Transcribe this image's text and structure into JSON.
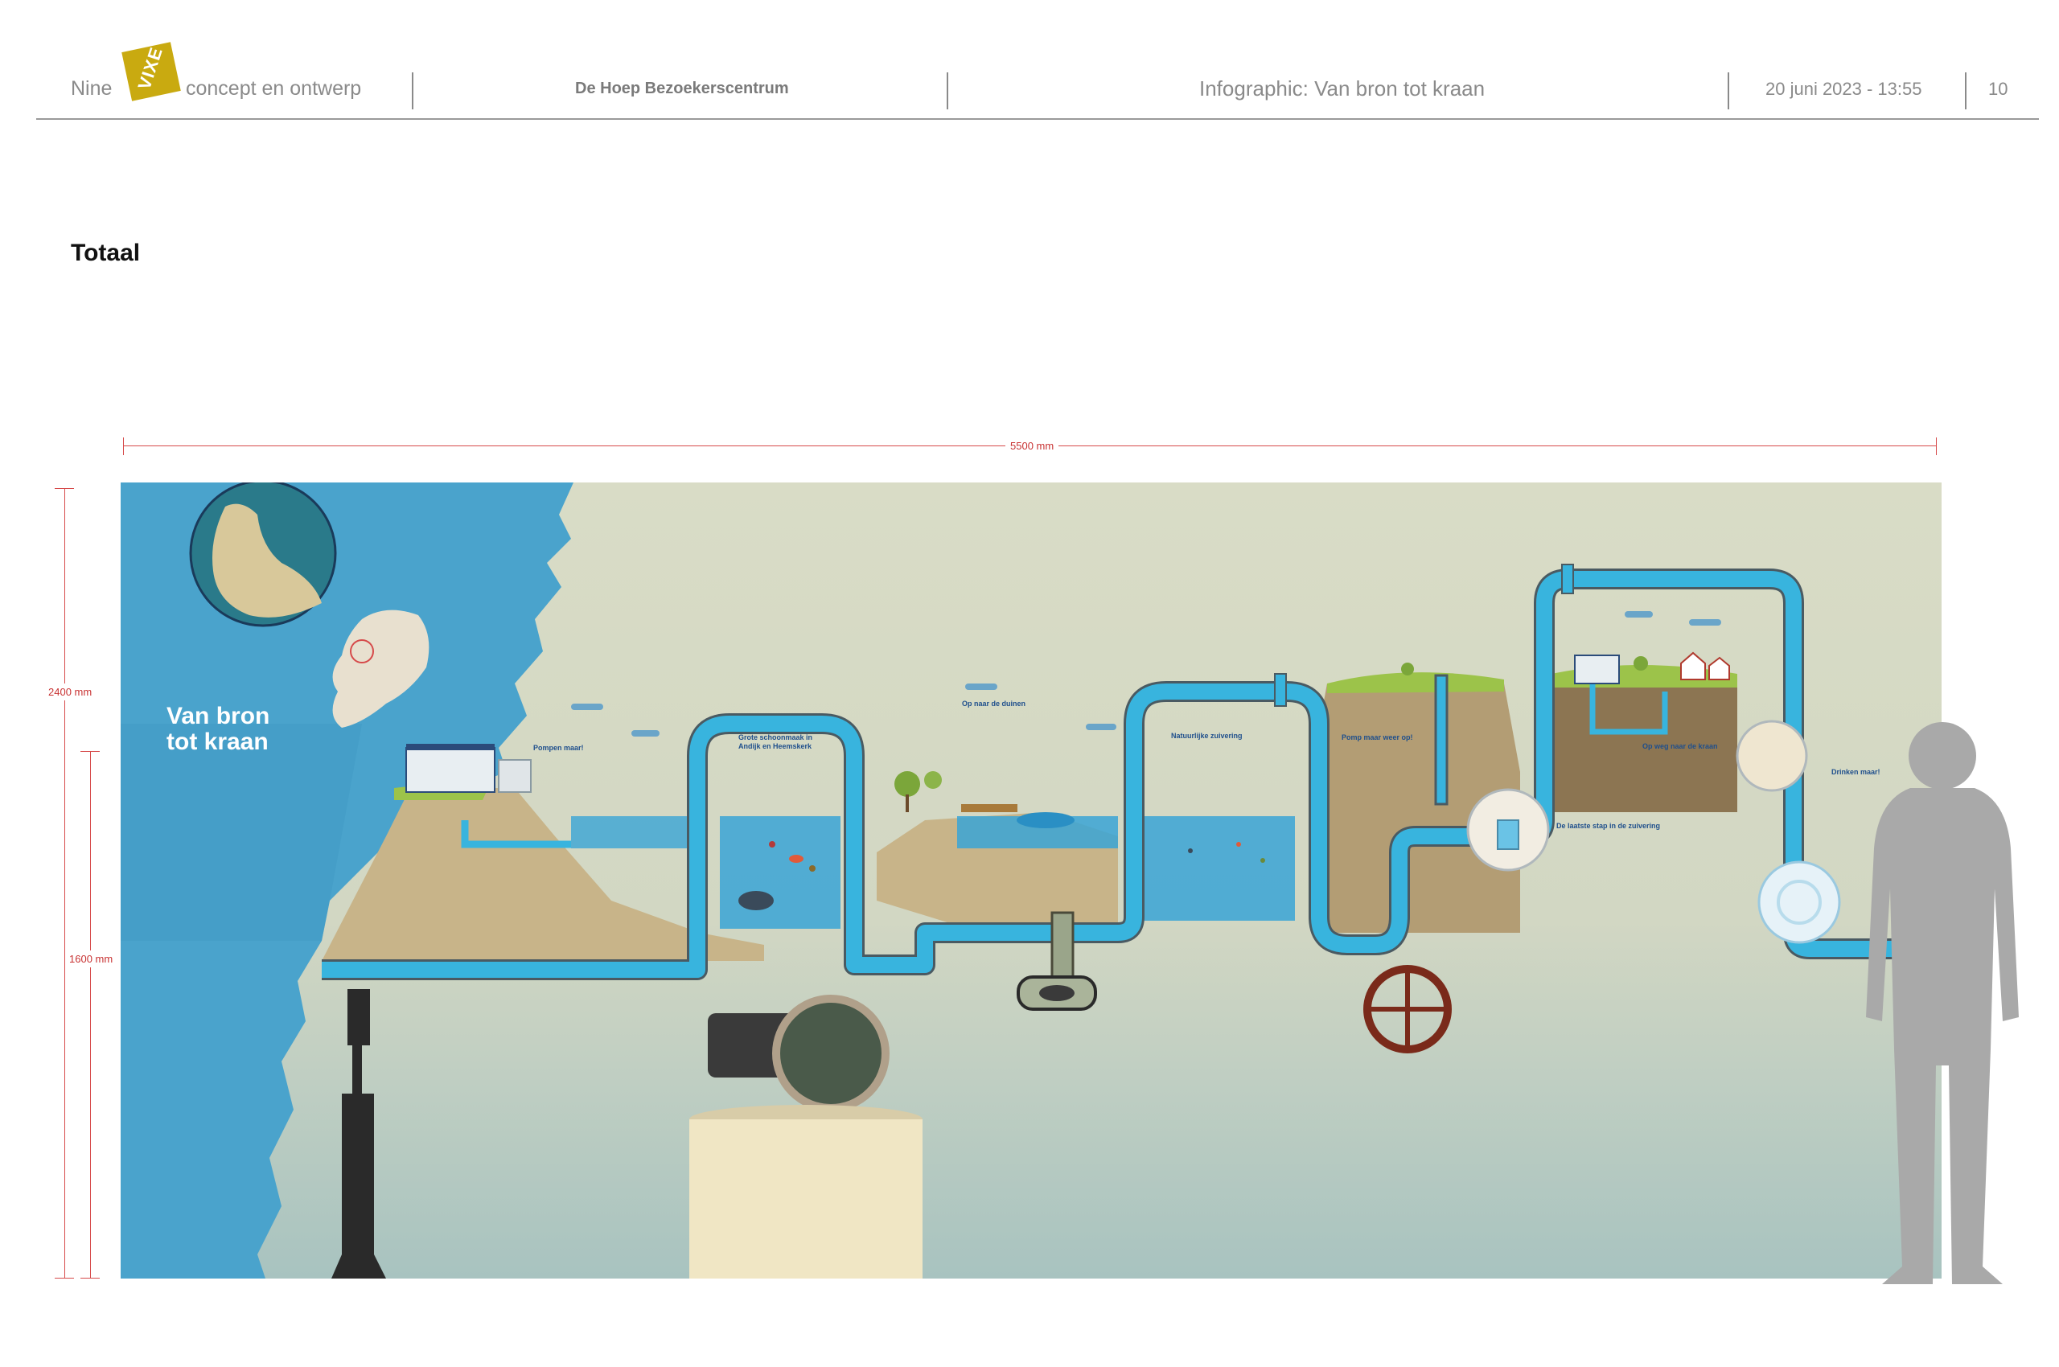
{
  "header": {
    "logo_left": "Nine",
    "logo_mark": "VIXE",
    "logo_right": "concept en ontwerp",
    "client": "De Hoep Bezoekerscentrum",
    "title": "Infographic: Van bron tot kraan",
    "datetime": "20  juni  2023  -  13:55",
    "page_number": "10"
  },
  "section_title": "Totaal",
  "dimensions": {
    "width_label": "5500 mm",
    "height_total_label": "2400 mm",
    "height_inner_label": "1600 mm"
  },
  "infographic": {
    "title_line1": "Van bron",
    "title_line2": "tot kraan",
    "panels": [
      {
        "key": "pompen",
        "title": "Pompen maar!"
      },
      {
        "key": "schoonmaak",
        "title": "Grote schoonmaak in Andijk en Heemskerk"
      },
      {
        "key": "duinen",
        "title": "Op naar de duinen"
      },
      {
        "key": "zuivering",
        "title": "Natuurlijke zuivering"
      },
      {
        "key": "pomp",
        "title": "Pomp maar weer op!"
      },
      {
        "key": "laatste",
        "title": "De laatste stap in de zuivering"
      },
      {
        "key": "kraan",
        "title": "Op weg naar de kraan"
      },
      {
        "key": "drinken",
        "title": "Drinken maar!"
      }
    ]
  },
  "colors": {
    "accent_gold": "#c9aa10",
    "sea_blue": "#4aa3cc",
    "pipe_blue": "#38b4de",
    "dimension_red": "#c83232",
    "header_grey": "#8a8a8a"
  }
}
